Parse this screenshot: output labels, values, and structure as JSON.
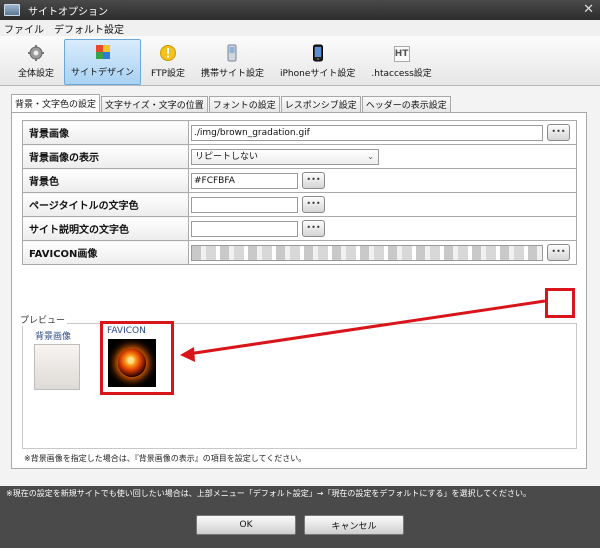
{
  "window": {
    "title": "サイトオプション",
    "close_glyph": "✕",
    "icon": "app-icon"
  },
  "menu": {
    "items": [
      "ファイル",
      "デフォルト設定"
    ]
  },
  "toolbar": {
    "items": [
      {
        "label": "全体設定",
        "icon": "gear-icon",
        "active": false
      },
      {
        "label": "サイトデザイン",
        "icon": "design-icon",
        "active": true
      },
      {
        "label": "FTP設定",
        "icon": "ftp-icon",
        "active": false
      },
      {
        "label": "携帯サイト設定",
        "icon": "mobile-icon",
        "active": false
      },
      {
        "label": "iPhoneサイト設定",
        "icon": "iphone-icon",
        "active": false
      },
      {
        "label": ".htaccess設定",
        "icon": "htaccess-icon",
        "active": false
      }
    ],
    "htaccess_glyph": "HT"
  },
  "tabs": [
    {
      "label": "背景・文字色の設定",
      "active": true
    },
    {
      "label": "文字サイズ・文字の位置",
      "active": false
    },
    {
      "label": "フォントの設定",
      "active": false
    },
    {
      "label": "レスポンシブ設定",
      "active": false
    },
    {
      "label": "ヘッダーの表示設定",
      "active": false
    }
  ],
  "form": {
    "bg_image": {
      "label": "背景画像",
      "value": "./img/brown_gradation.gif"
    },
    "bg_display": {
      "label": "背景画像の表示",
      "value": "リピートしない"
    },
    "bg_color": {
      "label": "背景色",
      "value": "#FCFBFA"
    },
    "page_title_color": {
      "label": "ページタイトルの文字色",
      "value": ""
    },
    "site_desc_color": {
      "label": "サイト説明文の文字色",
      "value": ""
    },
    "favicon": {
      "label": "FAVICON画像",
      "value": ""
    },
    "browse_glyph": "•••"
  },
  "preview": {
    "label": "プレビュー",
    "bg_title": "背景画像",
    "favicon_title": "FAVICON"
  },
  "note": "※背景画像を指定した場合は、『背景画像の表示』の項目を設定してください。",
  "footer": {
    "note": "※現在の設定を新規サイトでも使い回したい場合は、上部メニュー「デフォルト設定」→「現在の設定をデフォルトにする」を選択してください。",
    "ok_label": "OK",
    "cancel_label": "キャンセル"
  },
  "colors": {
    "highlight": "#d8151b",
    "active_tool": "#a9d2f4"
  }
}
